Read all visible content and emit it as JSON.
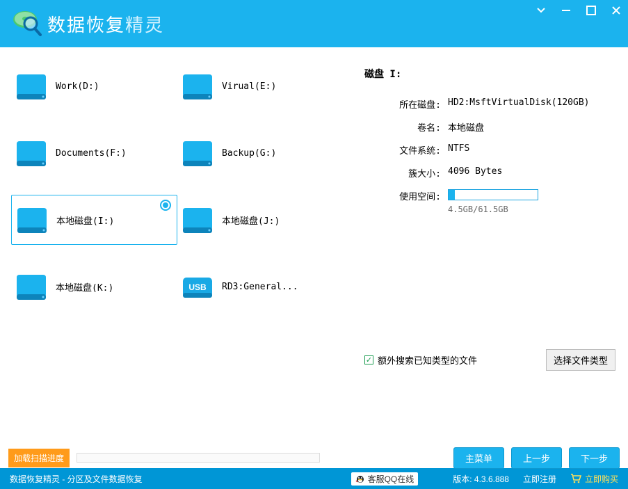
{
  "app": {
    "title_main": "数据恢复",
    "title_sub": "精灵"
  },
  "drives": [
    {
      "label": "Work(D:)",
      "type": "hdd"
    },
    {
      "label": "Virual(E:)",
      "type": "hdd"
    },
    {
      "label": "Documents(F:)",
      "type": "hdd"
    },
    {
      "label": "Backup(G:)",
      "type": "hdd"
    },
    {
      "label": "本地磁盘(I:)",
      "type": "hdd",
      "selected": true
    },
    {
      "label": "本地磁盘(J:)",
      "type": "hdd"
    },
    {
      "label": "本地磁盘(K:)",
      "type": "hdd"
    },
    {
      "label": "RD3:General...",
      "type": "usb"
    }
  ],
  "details": {
    "title": "磁盘 I:",
    "rows": {
      "disk_label": "所在磁盘:",
      "disk_value": "HD2:MsftVirtualDisk(120GB)",
      "volname_label": "卷名:",
      "volname_value": "本地磁盘",
      "fs_label": "文件系统:",
      "fs_value": "NTFS",
      "cluster_label": "簇大小:",
      "cluster_value": "4096 Bytes",
      "usage_label": "使用空间:",
      "usage_text": "4.5GB/61.5GB",
      "usage_percent": 7
    }
  },
  "extra_search_label": "额外搜索已知类型的文件",
  "select_type_btn": "选择文件类型",
  "bottom": {
    "load_progress": "加载扫描进度",
    "main_menu": "主菜单",
    "prev": "上一步",
    "next": "下一步"
  },
  "footer": {
    "left": "数据恢复精灵 - 分区及文件数据恢复",
    "qq": "客服QQ在线",
    "version_label": "版本:",
    "version": "4.3.6.888",
    "register": "立即注册",
    "buy": "立即购买"
  }
}
